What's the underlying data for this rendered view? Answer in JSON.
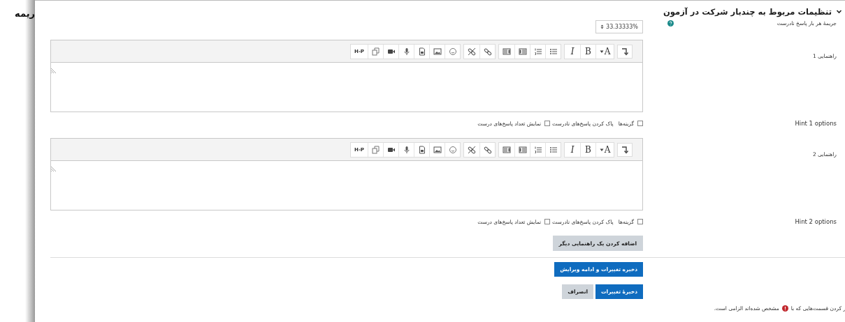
{
  "background_page": {
    "title_fragment": "ریمه"
  },
  "section": {
    "title": "تنظیمات مربوط به چندبار شرکت در آزمون",
    "expanded": true
  },
  "penalty": {
    "label": "جریمهٔ هر بار پاسخ نادرست",
    "value": "33.33333%"
  },
  "hints": [
    {
      "label": "راهنمایی 1",
      "toolbar": [
        [
          {
            "kind": "expand"
          }
        ],
        [
          {
            "kind": "style",
            "label": "A"
          },
          {
            "kind": "bold",
            "label": "B"
          },
          {
            "kind": "italic",
            "label": "I"
          }
        ],
        [
          {
            "kind": "ul"
          },
          {
            "kind": "ol"
          },
          {
            "kind": "outdent"
          },
          {
            "kind": "indent"
          }
        ],
        [
          {
            "kind": "link"
          },
          {
            "kind": "unlink"
          }
        ],
        [
          {
            "kind": "emoji"
          },
          {
            "kind": "image"
          },
          {
            "kind": "file"
          },
          {
            "kind": "mic"
          },
          {
            "kind": "video"
          },
          {
            "kind": "copy"
          },
          {
            "kind": "text",
            "label": "H-P"
          }
        ]
      ],
      "options_label": "Hint 1 options",
      "options": [
        {
          "label": "گزینه‌ها   پاک کردن پاسخ‌های نادرست",
          "checked": false
        },
        {
          "label": "نمایش تعداد پاسخ‌های درست",
          "checked": false
        }
      ]
    },
    {
      "label": "راهنمایی 2",
      "toolbar": [
        [
          {
            "kind": "expand"
          }
        ],
        [
          {
            "kind": "style",
            "label": "A"
          },
          {
            "kind": "bold",
            "label": "B"
          },
          {
            "kind": "italic",
            "label": "I"
          }
        ],
        [
          {
            "kind": "ul"
          },
          {
            "kind": "ol"
          },
          {
            "kind": "outdent"
          },
          {
            "kind": "indent"
          }
        ],
        [
          {
            "kind": "link"
          },
          {
            "kind": "unlink"
          }
        ],
        [
          {
            "kind": "emoji"
          },
          {
            "kind": "image"
          },
          {
            "kind": "file"
          },
          {
            "kind": "mic"
          },
          {
            "kind": "video"
          },
          {
            "kind": "copy"
          },
          {
            "kind": "text",
            "label": "H-P"
          }
        ]
      ],
      "options_label": "Hint 2 options",
      "options": [
        {
          "label": "گزینه‌ها   پاک کردن پاسخ‌های نادرست",
          "checked": false
        },
        {
          "label": "نمایش تعداد پاسخ‌های درست",
          "checked": false
        }
      ]
    }
  ],
  "add_hint_button": "اضافه کردن یک راهنمایی دیگر",
  "buttons": [
    {
      "label": "ذخیره تغییرات و ادامه ویرایش",
      "kind": "primary"
    },
    {
      "label": "ذخیرهٔ تغییرات",
      "kind": "primary"
    },
    {
      "label": "انصراف",
      "kind": "secondary"
    }
  ],
  "required_note": {
    "before": "ر کردن قسمت‌هایی که با",
    "after": "مشخص شده‌اند الزامی است."
  }
}
